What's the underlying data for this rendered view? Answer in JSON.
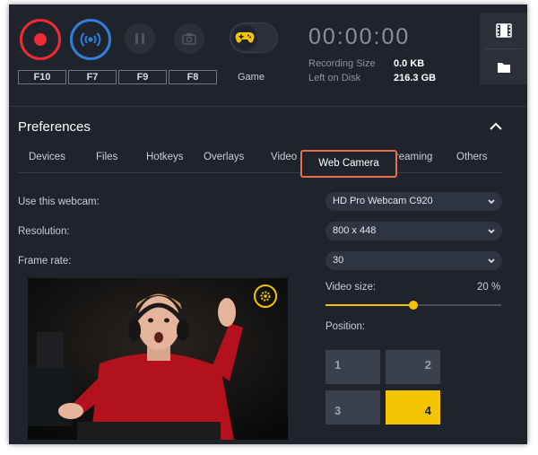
{
  "toolbar": {
    "hotkeys": [
      "F10",
      "F7",
      "F9",
      "F8"
    ],
    "game_label": "Game",
    "timer": "00:00:00",
    "recording_size_label": "Recording Size",
    "recording_size_value": "0.0 KB",
    "left_on_disk_label": "Left on Disk",
    "left_on_disk_value": "216.3 GB",
    "icons": [
      "record-icon",
      "stream-icon",
      "pause-icon",
      "camera-icon",
      "gamepad-icon",
      "film-icon",
      "folder-icon"
    ]
  },
  "preferences": {
    "title": "Preferences",
    "tabs": [
      "Devices",
      "Files",
      "Hotkeys",
      "Overlays",
      "Video",
      "Web Camera",
      "Streaming",
      "Others"
    ],
    "active_tab": "Web Camera",
    "webcam_label": "Use this webcam:",
    "webcam_value": "HD Pro Webcam C920",
    "resolution_label": "Resolution:",
    "resolution_value": "800 x 448",
    "framerate_label": "Frame rate:",
    "framerate_value": "30",
    "video_size_label": "Video size:",
    "video_size_value": "20 %",
    "video_size_fraction": 0.5,
    "position_label": "Position:",
    "positions": [
      "1",
      "2",
      "3",
      "4"
    ],
    "selected_position": "4"
  },
  "colors": {
    "accent": "#f5c400",
    "record": "#ee2a34",
    "stream": "#2f7fd9",
    "highlight": "#e86f4c"
  }
}
